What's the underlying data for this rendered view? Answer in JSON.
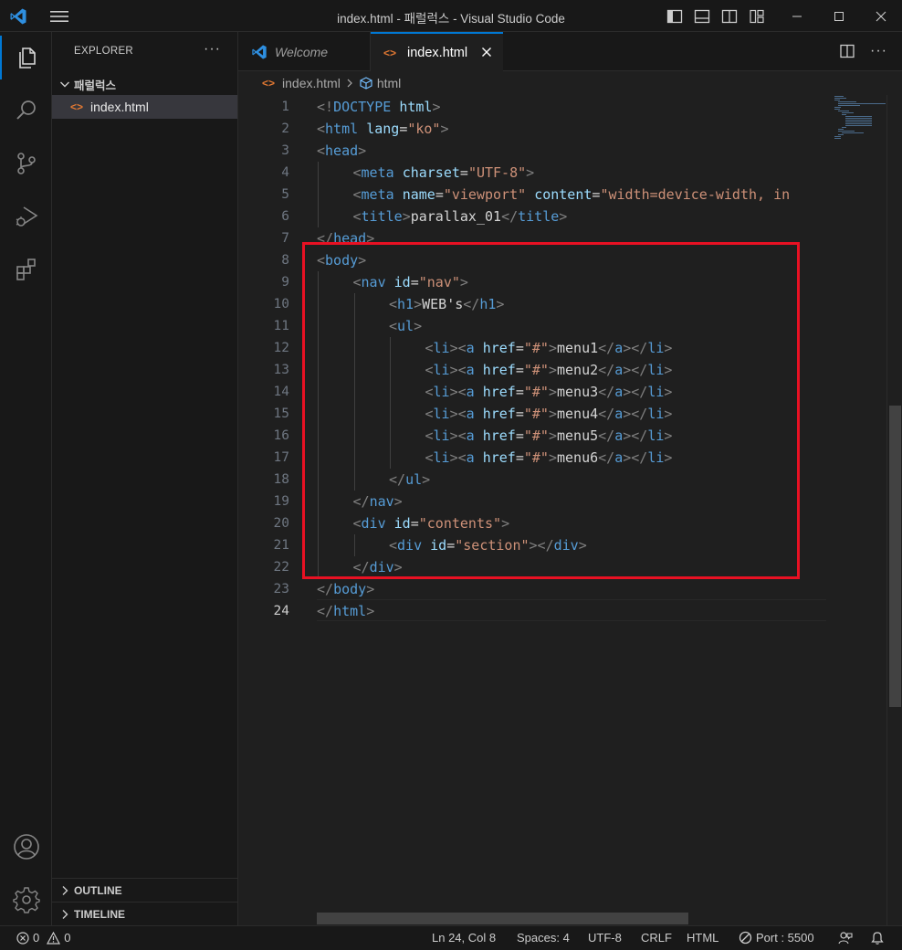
{
  "window": {
    "title": "index.html - 패럴럭스 - Visual Studio Code"
  },
  "explorer": {
    "title": "EXPLORER",
    "more": "···",
    "folder": "패럴럭스",
    "files": [
      {
        "name": "index.html",
        "icon": "<>"
      }
    ],
    "outline_label": "OUTLINE",
    "timeline_label": "TIMELINE"
  },
  "tabs": [
    {
      "label": "Welcome",
      "active": false
    },
    {
      "label": "index.html",
      "active": true
    }
  ],
  "breadcrumb": {
    "file": "index.html",
    "symbol": "html"
  },
  "editor": {
    "current_line": 24,
    "lines": [
      {
        "n": "1",
        "indent": 0,
        "tokens": [
          [
            "br",
            "<!"
          ],
          [
            "tg",
            "DOCTYPE"
          ],
          [
            "tx",
            " "
          ],
          [
            "at",
            "html"
          ],
          [
            "br",
            ">"
          ]
        ]
      },
      {
        "n": "2",
        "indent": 0,
        "tokens": [
          [
            "br",
            "<"
          ],
          [
            "tg",
            "html"
          ],
          [
            "tx",
            " "
          ],
          [
            "at",
            "lang"
          ],
          [
            "tx",
            "="
          ],
          [
            "st",
            "\"ko\""
          ],
          [
            "br",
            ">"
          ]
        ]
      },
      {
        "n": "3",
        "indent": 0,
        "tokens": [
          [
            "br",
            "<"
          ],
          [
            "tg",
            "head"
          ],
          [
            "br",
            ">"
          ]
        ]
      },
      {
        "n": "4",
        "indent": 1,
        "tokens": [
          [
            "br",
            "<"
          ],
          [
            "tg",
            "meta"
          ],
          [
            "tx",
            " "
          ],
          [
            "at",
            "charset"
          ],
          [
            "tx",
            "="
          ],
          [
            "st",
            "\"UTF-8\""
          ],
          [
            "br",
            ">"
          ]
        ]
      },
      {
        "n": "5",
        "indent": 1,
        "tokens": [
          [
            "br",
            "<"
          ],
          [
            "tg",
            "meta"
          ],
          [
            "tx",
            " "
          ],
          [
            "at",
            "name"
          ],
          [
            "tx",
            "="
          ],
          [
            "st",
            "\"viewport\""
          ],
          [
            "tx",
            " "
          ],
          [
            "at",
            "content"
          ],
          [
            "tx",
            "="
          ],
          [
            "st",
            "\"width=device-width, in"
          ]
        ]
      },
      {
        "n": "6",
        "indent": 1,
        "tokens": [
          [
            "br",
            "<"
          ],
          [
            "tg",
            "title"
          ],
          [
            "br",
            ">"
          ],
          [
            "tx",
            "parallax_01"
          ],
          [
            "br",
            "</"
          ],
          [
            "tg",
            "title"
          ],
          [
            "br",
            ">"
          ]
        ]
      },
      {
        "n": "7",
        "indent": 0,
        "tokens": [
          [
            "br",
            "</"
          ],
          [
            "tg",
            "head"
          ],
          [
            "br",
            ">"
          ]
        ]
      },
      {
        "n": "8",
        "indent": 0,
        "tokens": [
          [
            "br",
            "<"
          ],
          [
            "tg",
            "body"
          ],
          [
            "br",
            ">"
          ]
        ]
      },
      {
        "n": "9",
        "indent": 1,
        "tokens": [
          [
            "br",
            "<"
          ],
          [
            "tg",
            "nav"
          ],
          [
            "tx",
            " "
          ],
          [
            "at",
            "id"
          ],
          [
            "tx",
            "="
          ],
          [
            "st",
            "\"nav\""
          ],
          [
            "br",
            ">"
          ]
        ]
      },
      {
        "n": "10",
        "indent": 2,
        "tokens": [
          [
            "br",
            "<"
          ],
          [
            "tg",
            "h1"
          ],
          [
            "br",
            ">"
          ],
          [
            "tx",
            "WEB's"
          ],
          [
            "br",
            "</"
          ],
          [
            "tg",
            "h1"
          ],
          [
            "br",
            ">"
          ]
        ]
      },
      {
        "n": "11",
        "indent": 2,
        "tokens": [
          [
            "br",
            "<"
          ],
          [
            "tg",
            "ul"
          ],
          [
            "br",
            ">"
          ]
        ]
      },
      {
        "n": "12",
        "indent": 3,
        "tokens": [
          [
            "br",
            "<"
          ],
          [
            "tg",
            "li"
          ],
          [
            "br",
            "><"
          ],
          [
            "tg",
            "a"
          ],
          [
            "tx",
            " "
          ],
          [
            "at",
            "href"
          ],
          [
            "tx",
            "="
          ],
          [
            "st",
            "\"#\""
          ],
          [
            "br",
            ">"
          ],
          [
            "tx",
            "menu1"
          ],
          [
            "br",
            "</"
          ],
          [
            "tg",
            "a"
          ],
          [
            "br",
            "></"
          ],
          [
            "tg",
            "li"
          ],
          [
            "br",
            ">"
          ]
        ]
      },
      {
        "n": "13",
        "indent": 3,
        "tokens": [
          [
            "br",
            "<"
          ],
          [
            "tg",
            "li"
          ],
          [
            "br",
            "><"
          ],
          [
            "tg",
            "a"
          ],
          [
            "tx",
            " "
          ],
          [
            "at",
            "href"
          ],
          [
            "tx",
            "="
          ],
          [
            "st",
            "\"#\""
          ],
          [
            "br",
            ">"
          ],
          [
            "tx",
            "menu2"
          ],
          [
            "br",
            "</"
          ],
          [
            "tg",
            "a"
          ],
          [
            "br",
            "></"
          ],
          [
            "tg",
            "li"
          ],
          [
            "br",
            ">"
          ]
        ]
      },
      {
        "n": "14",
        "indent": 3,
        "tokens": [
          [
            "br",
            "<"
          ],
          [
            "tg",
            "li"
          ],
          [
            "br",
            "><"
          ],
          [
            "tg",
            "a"
          ],
          [
            "tx",
            " "
          ],
          [
            "at",
            "href"
          ],
          [
            "tx",
            "="
          ],
          [
            "st",
            "\"#\""
          ],
          [
            "br",
            ">"
          ],
          [
            "tx",
            "menu3"
          ],
          [
            "br",
            "</"
          ],
          [
            "tg",
            "a"
          ],
          [
            "br",
            "></"
          ],
          [
            "tg",
            "li"
          ],
          [
            "br",
            ">"
          ]
        ]
      },
      {
        "n": "15",
        "indent": 3,
        "tokens": [
          [
            "br",
            "<"
          ],
          [
            "tg",
            "li"
          ],
          [
            "br",
            "><"
          ],
          [
            "tg",
            "a"
          ],
          [
            "tx",
            " "
          ],
          [
            "at",
            "href"
          ],
          [
            "tx",
            "="
          ],
          [
            "st",
            "\"#\""
          ],
          [
            "br",
            ">"
          ],
          [
            "tx",
            "menu4"
          ],
          [
            "br",
            "</"
          ],
          [
            "tg",
            "a"
          ],
          [
            "br",
            "></"
          ],
          [
            "tg",
            "li"
          ],
          [
            "br",
            ">"
          ]
        ]
      },
      {
        "n": "16",
        "indent": 3,
        "tokens": [
          [
            "br",
            "<"
          ],
          [
            "tg",
            "li"
          ],
          [
            "br",
            "><"
          ],
          [
            "tg",
            "a"
          ],
          [
            "tx",
            " "
          ],
          [
            "at",
            "href"
          ],
          [
            "tx",
            "="
          ],
          [
            "st",
            "\"#\""
          ],
          [
            "br",
            ">"
          ],
          [
            "tx",
            "menu5"
          ],
          [
            "br",
            "</"
          ],
          [
            "tg",
            "a"
          ],
          [
            "br",
            "></"
          ],
          [
            "tg",
            "li"
          ],
          [
            "br",
            ">"
          ]
        ]
      },
      {
        "n": "17",
        "indent": 3,
        "tokens": [
          [
            "br",
            "<"
          ],
          [
            "tg",
            "li"
          ],
          [
            "br",
            "><"
          ],
          [
            "tg",
            "a"
          ],
          [
            "tx",
            " "
          ],
          [
            "at",
            "href"
          ],
          [
            "tx",
            "="
          ],
          [
            "st",
            "\"#\""
          ],
          [
            "br",
            ">"
          ],
          [
            "tx",
            "menu6"
          ],
          [
            "br",
            "</"
          ],
          [
            "tg",
            "a"
          ],
          [
            "br",
            "></"
          ],
          [
            "tg",
            "li"
          ],
          [
            "br",
            ">"
          ]
        ]
      },
      {
        "n": "18",
        "indent": 2,
        "tokens": [
          [
            "br",
            "</"
          ],
          [
            "tg",
            "ul"
          ],
          [
            "br",
            ">"
          ]
        ]
      },
      {
        "n": "19",
        "indent": 1,
        "tokens": [
          [
            "br",
            "</"
          ],
          [
            "tg",
            "nav"
          ],
          [
            "br",
            ">"
          ]
        ]
      },
      {
        "n": "20",
        "indent": 1,
        "tokens": [
          [
            "br",
            "<"
          ],
          [
            "tg",
            "div"
          ],
          [
            "tx",
            " "
          ],
          [
            "at",
            "id"
          ],
          [
            "tx",
            "="
          ],
          [
            "st",
            "\"contents\""
          ],
          [
            "br",
            ">"
          ]
        ]
      },
      {
        "n": "21",
        "indent": 2,
        "tokens": [
          [
            "br",
            "<"
          ],
          [
            "tg",
            "div"
          ],
          [
            "tx",
            " "
          ],
          [
            "at",
            "id"
          ],
          [
            "tx",
            "="
          ],
          [
            "st",
            "\"section\""
          ],
          [
            "br",
            "></"
          ],
          [
            "tg",
            "div"
          ],
          [
            "br",
            ">"
          ]
        ]
      },
      {
        "n": "22",
        "indent": 1,
        "tokens": [
          [
            "br",
            "</"
          ],
          [
            "tg",
            "div"
          ],
          [
            "br",
            ">"
          ]
        ]
      },
      {
        "n": "23",
        "indent": 0,
        "tokens": [
          [
            "br",
            "</"
          ],
          [
            "tg",
            "body"
          ],
          [
            "br",
            ">"
          ]
        ]
      },
      {
        "n": "24",
        "indent": 0,
        "tokens": [
          [
            "br",
            "</"
          ],
          [
            "tg",
            "html"
          ],
          [
            "br",
            ">"
          ]
        ]
      }
    ]
  },
  "statusbar": {
    "errors": "0",
    "warnings": "0",
    "position": "Ln 24, Col 8",
    "spaces": "Spaces: 4",
    "encoding": "UTF-8",
    "eol": "CRLF",
    "language": "HTML",
    "port": "Port : 5500"
  },
  "colors": {
    "accent": "#0078d4",
    "highlight_box": "#e81123",
    "tag": "#569cd6",
    "attribute": "#9cdcfe",
    "string": "#ce9178"
  },
  "icons": {
    "activity": [
      "explorer-icon",
      "search-icon",
      "source-control-icon",
      "run-debug-icon",
      "extensions-icon",
      "account-icon",
      "manage-gear-icon"
    ]
  }
}
